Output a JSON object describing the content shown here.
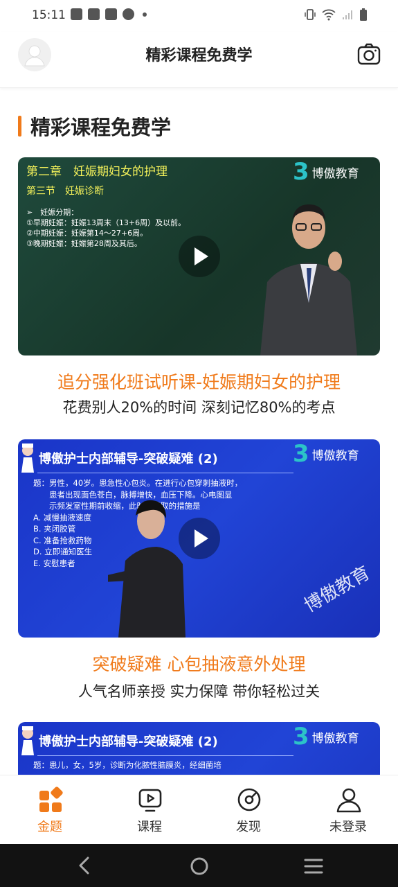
{
  "status": {
    "time": "15:11"
  },
  "header": {
    "title": "精彩课程免费学"
  },
  "section": {
    "title": "精彩课程免费学"
  },
  "logo": {
    "text": "博傲教育"
  },
  "courses": [
    {
      "title": "追分强化班试听课-妊娠期妇女的护理",
      "subtitle": "花费别人20%的时间 深刻记忆80%的考点",
      "thumb": {
        "chapter": "第二章　妊娠期妇女的护理",
        "section": "第三节　妊娠诊断",
        "lines": "➢　妊娠分期：\n①早期妊娠：妊娠13周末（13+6周）及以前。\n②中期妊娠：妊娠第14～27+6周。\n③晚期妊娠：妊娠第28周及其后。"
      }
    },
    {
      "title": "突破疑难 心包抽液意外处理",
      "subtitle": "人气名师亲授 实力保障 带你轻松过关",
      "thumb": {
        "heading": "博傲护士内部辅导-突破疑难 (2)",
        "lines": "题：男性，40岁。患急性心包炎。在进行心包穿刺抽液时，\n　　患者出现面色苍白，脉搏增快，血压下降。心电图显\n　　示频发室性期前收缩，此时应采取的措施是\nA. 减慢抽液速度\nB. 夹闭胶管\nC. 准备抢救药物\nD. 立即通知医生\nE. 安慰患者",
        "watermark": "博傲教育"
      }
    },
    {
      "thumb": {
        "heading": "博傲护士内部辅导-突破疑难 (2)",
        "lines": "题：患儿，女，5岁，诊断为化脓性脑膜炎，经细菌培"
      }
    }
  ],
  "nav": [
    {
      "label": "金题",
      "active": true,
      "icon": "grid-icon"
    },
    {
      "label": "课程",
      "active": false,
      "icon": "video-icon"
    },
    {
      "label": "发现",
      "active": false,
      "icon": "discover-icon"
    },
    {
      "label": "未登录",
      "active": false,
      "icon": "user-icon"
    }
  ],
  "colors": {
    "accent": "#f07a1a",
    "green_slide": "#1f4a3c",
    "blue_slide": "#2144d6",
    "slide_yellow": "#f5f25a"
  }
}
